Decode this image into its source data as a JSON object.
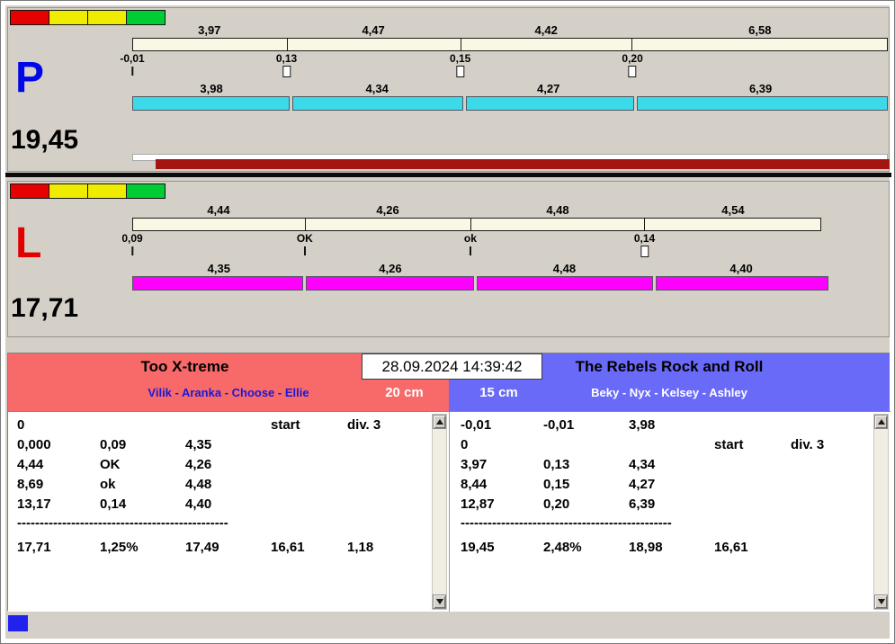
{
  "datetime": "28.09.2024 14:39:42",
  "legend_colors": [
    "#e60000",
    "#f0ec00",
    "#f0ec00",
    "#00cc33"
  ],
  "colors": {
    "lane_p_letter": "#0008e8",
    "lane_l_letter": "#e00000",
    "lane_p_bar": "#3cd9e9",
    "lane_l_bar": "#ff00ff",
    "upper_bar": "#faf8e4",
    "team_left": "#f86a6a",
    "team_right": "#6a6af8",
    "progress_fill": "#a41410",
    "status_indicator": "#2222ee"
  },
  "lanes": {
    "p": {
      "letter": "P",
      "total": "19,45",
      "upper_labels": [
        "3,97",
        "4,47",
        "4,42",
        "6,58"
      ],
      "lower_labels": [
        "3,98",
        "4,34",
        "4,27",
        "6,39"
      ],
      "ticks": [
        {
          "label": "-0,01",
          "marker": "line"
        },
        {
          "label": "0,13",
          "marker": "box"
        },
        {
          "label": "0,15",
          "marker": "box"
        },
        {
          "label": "0,20",
          "marker": "box"
        }
      ]
    },
    "l": {
      "letter": "L",
      "total": "17,71",
      "upper_labels": [
        "4,44",
        "4,26",
        "4,48",
        "4,54"
      ],
      "lower_labels": [
        "4,35",
        "4,26",
        "4,48",
        "4,40"
      ],
      "ticks": [
        {
          "label": "0,09",
          "marker": "line"
        },
        {
          "label": "OK",
          "marker": "line"
        },
        {
          "label": "ok",
          "marker": "line"
        },
        {
          "label": "0,14",
          "marker": "box"
        }
      ]
    }
  },
  "teams": {
    "left": {
      "name": "Too X-treme",
      "members": "Vilik - Aranka - Choose - Ellie",
      "distance": "20 cm",
      "rows": [
        [
          "0",
          "",
          "",
          "start",
          "div. 3"
        ],
        [
          "0,000",
          "0,09",
          "4,35",
          "",
          ""
        ],
        [
          "4,44",
          "OK",
          "4,26",
          "",
          ""
        ],
        [
          "8,69",
          "ok",
          "4,48",
          "",
          ""
        ],
        [
          "13,17",
          "0,14",
          "4,40",
          "",
          ""
        ]
      ],
      "separator": "-----------------------------------------------",
      "totals": [
        "17,71",
        "1,25%",
        "17,49",
        "16,61",
        "1,18"
      ]
    },
    "right": {
      "name": "The Rebels Rock and Roll",
      "members": "Beky - Nyx - Kelsey - Ashley",
      "distance": "15 cm",
      "rows": [
        [
          "-0,01",
          "-0,01",
          "3,98",
          "",
          ""
        ],
        [
          "0",
          "",
          "",
          "start",
          "div. 3"
        ],
        [
          "3,97",
          "0,13",
          "4,34",
          "",
          ""
        ],
        [
          "8,44",
          "0,15",
          "4,27",
          "",
          ""
        ],
        [
          "12,87",
          "0,20",
          "6,39",
          "",
          ""
        ]
      ],
      "separator": "-----------------------------------------------",
      "totals": [
        "19,45",
        "2,48%",
        "18,98",
        "16,61",
        ""
      ]
    }
  }
}
